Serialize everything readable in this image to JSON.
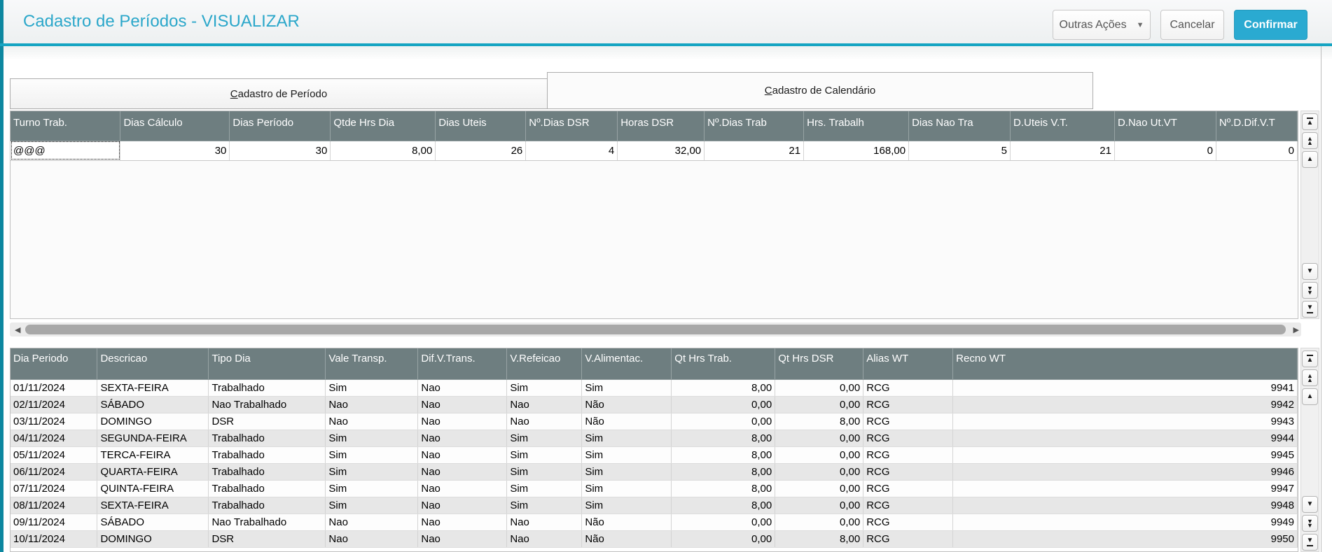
{
  "window": {
    "title": "Cadastro de Períodos - VISUALIZAR"
  },
  "toolbar": {
    "other_actions_label": "Outras Ações",
    "cancel_label": "Cancelar",
    "confirm_label": "Confirmar"
  },
  "tabs": [
    {
      "label": "Cadastro de Período"
    },
    {
      "label": "Cadastro de Calendário"
    }
  ],
  "period_grid": {
    "columns": [
      "Turno Trab.",
      "Dias Cálculo",
      "Dias Período",
      "Qtde Hrs Dia",
      "Dias Uteis",
      "Nº.Dias DSR",
      "Horas DSR",
      "Nº.Dias Trab",
      "Hrs. Trabalh",
      "Dias Nao Tra",
      "D.Uteis V.T.",
      "D.Nao Ut.VT",
      "Nº.D.Dif.V.T"
    ],
    "rows": [
      [
        "@@@",
        "30",
        "30",
        "8,00",
        "26",
        "4",
        "32,00",
        "21",
        "168,00",
        "5",
        "21",
        "0",
        "0"
      ]
    ],
    "focused_cell": {
      "row": 0,
      "col": 0
    }
  },
  "calendar_grid": {
    "columns": [
      "Dia Periodo",
      "Descricao",
      "Tipo Dia",
      "Vale Transp.",
      "Dif.V.Trans.",
      "V.Refeicao",
      "V.Alimentac.",
      "Qt Hrs Trab.",
      "Qt Hrs DSR",
      "Alias WT",
      "Recno WT"
    ],
    "rows": [
      [
        "01/11/2024",
        "SEXTA-FEIRA",
        "Trabalhado",
        "Sim",
        "Nao",
        "Sim",
        "Sim",
        "8,00",
        "0,00",
        "RCG",
        "9941"
      ],
      [
        "02/11/2024",
        "SÁBADO",
        "Nao Trabalhado",
        "Nao",
        "Nao",
        "Nao",
        "Não",
        "0,00",
        "0,00",
        "RCG",
        "9942"
      ],
      [
        "03/11/2024",
        "DOMINGO",
        "DSR",
        "Nao",
        "Nao",
        "Nao",
        "Não",
        "0,00",
        "8,00",
        "RCG",
        "9943"
      ],
      [
        "04/11/2024",
        "SEGUNDA-FEIRA",
        "Trabalhado",
        "Sim",
        "Nao",
        "Sim",
        "Sim",
        "8,00",
        "0,00",
        "RCG",
        "9944"
      ],
      [
        "05/11/2024",
        "TERCA-FEIRA",
        "Trabalhado",
        "Sim",
        "Nao",
        "Sim",
        "Sim",
        "8,00",
        "0,00",
        "RCG",
        "9945"
      ],
      [
        "06/11/2024",
        "QUARTA-FEIRA",
        "Trabalhado",
        "Sim",
        "Nao",
        "Sim",
        "Sim",
        "8,00",
        "0,00",
        "RCG",
        "9946"
      ],
      [
        "07/11/2024",
        "QUINTA-FEIRA",
        "Trabalhado",
        "Sim",
        "Nao",
        "Sim",
        "Sim",
        "8,00",
        "0,00",
        "RCG",
        "9947"
      ],
      [
        "08/11/2024",
        "SEXTA-FEIRA",
        "Trabalhado",
        "Sim",
        "Nao",
        "Sim",
        "Sim",
        "8,00",
        "0,00",
        "RCG",
        "9948"
      ],
      [
        "09/11/2024",
        "SÁBADO",
        "Nao Trabalhado",
        "Nao",
        "Nao",
        "Nao",
        "Não",
        "0,00",
        "0,00",
        "RCG",
        "9949"
      ],
      [
        "10/11/2024",
        "DOMINGO",
        "DSR",
        "Nao",
        "Nao",
        "Nao",
        "Não",
        "0,00",
        "8,00",
        "RCG",
        "9950"
      ]
    ]
  },
  "icons": {
    "up": "▲",
    "down": "▼",
    "left": "◀",
    "right": "▶",
    "dropdown": "▼"
  },
  "colors": {
    "accent": "#2ba7ca",
    "header_underline": "#15a4c2",
    "left_bar": "#0d87a0",
    "confirm_bg": "#2aaad1",
    "grid_header_bg": "#6e7e80",
    "row_alt_bg": "#e7e7e7"
  }
}
